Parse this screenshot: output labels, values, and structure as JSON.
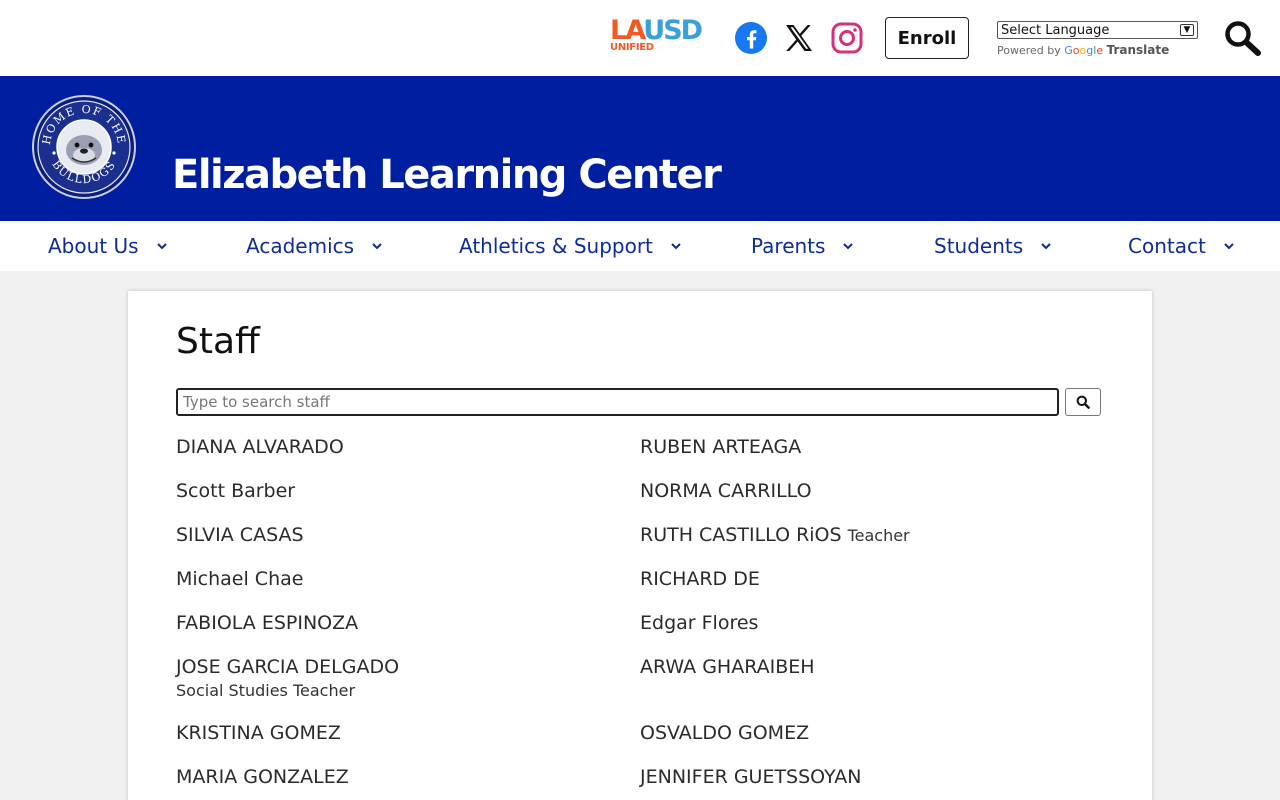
{
  "header": {
    "lausd": {
      "la": "LA",
      "usd": "USD",
      "unified": "UNIFIED"
    },
    "enroll_label": "Enroll",
    "language_select": "Select Language",
    "powered_by": "Powered by",
    "google": "Google",
    "translate": "Translate"
  },
  "banner": {
    "school_name": "Elizabeth Learning Center",
    "logo_text_top": "HOME OF THE",
    "logo_text_bottom": "BULLDOGS"
  },
  "nav": {
    "items": [
      {
        "label": "About Us"
      },
      {
        "label": "Academics"
      },
      {
        "label": "Athletics & Support"
      },
      {
        "label": "Parents"
      },
      {
        "label": "Students"
      },
      {
        "label": "Contact"
      }
    ]
  },
  "main": {
    "title": "Staff",
    "search_placeholder": "Type to search staff",
    "search_value": "",
    "staff": [
      {
        "name": "DIANA ALVARADO",
        "title": ""
      },
      {
        "name": "RUBEN ARTEAGA",
        "title": ""
      },
      {
        "name": "Scott Barber",
        "title": ""
      },
      {
        "name": "NORMA CARRILLO",
        "title": ""
      },
      {
        "name": "SILVIA CASAS",
        "title": ""
      },
      {
        "name": "RUTH CASTILLO RiOS",
        "title": "Teacher"
      },
      {
        "name": "Michael Chae",
        "title": ""
      },
      {
        "name": "RICHARD DE",
        "title": ""
      },
      {
        "name": "FABIOLA ESPINOZA",
        "title": ""
      },
      {
        "name": "Edgar Flores",
        "title": ""
      },
      {
        "name": "JOSE GARCIA DELGADO",
        "title": "Social Studies Teacher"
      },
      {
        "name": "ARWA GHARAIBEH",
        "title": ""
      },
      {
        "name": "KRISTINA GOMEZ",
        "title": ""
      },
      {
        "name": "OSVALDO GOMEZ",
        "title": ""
      },
      {
        "name": "MARIA GONZALEZ",
        "title": ""
      },
      {
        "name": "JENNIFER GUETSSOYAN",
        "title": ""
      }
    ]
  },
  "colors": {
    "banner": "#001ea0",
    "nav_text": "#0e2d95",
    "facebook": "#1877f2",
    "instagram": "#d6307c"
  }
}
